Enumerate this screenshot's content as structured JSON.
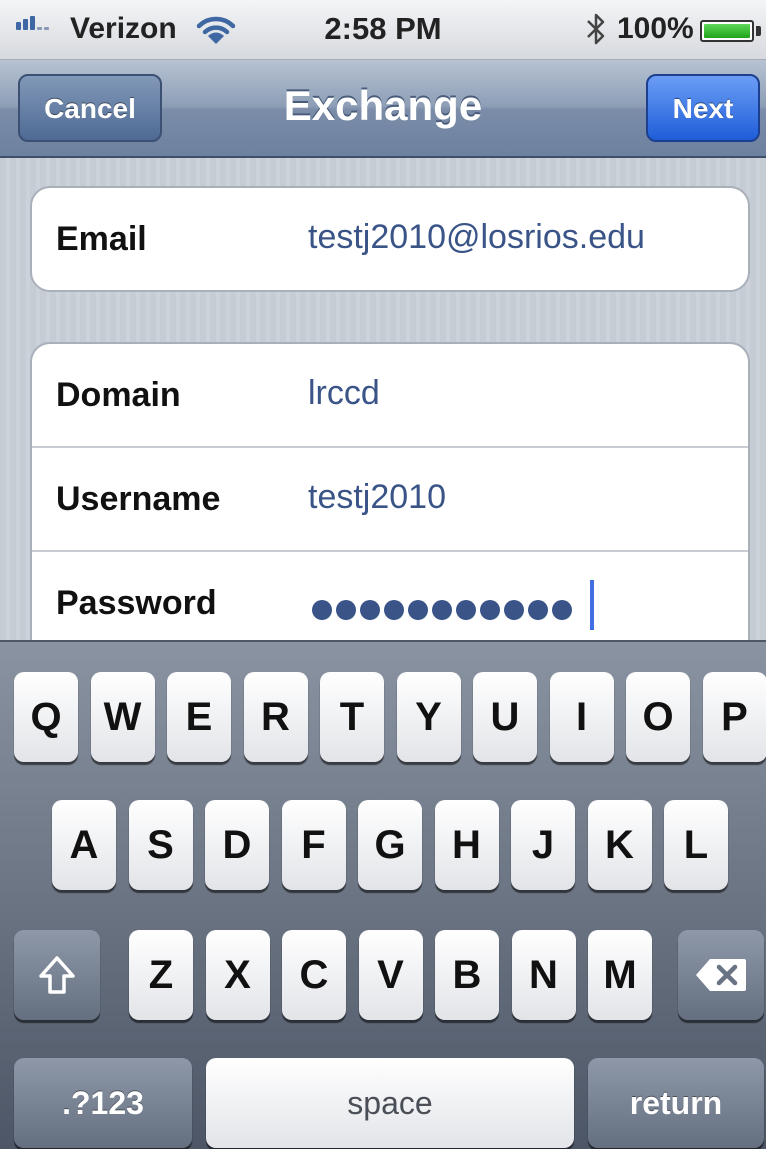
{
  "status_bar": {
    "carrier": "Verizon",
    "time": "2:58 PM",
    "battery_percent": "100%",
    "icons": [
      "signal-icon",
      "wifi-icon",
      "bluetooth-icon",
      "battery-icon"
    ]
  },
  "nav_bar": {
    "title": "Exchange",
    "cancel_label": "Cancel",
    "next_label": "Next"
  },
  "form": {
    "email": {
      "label": "Email",
      "value": "testj2010@losrios.edu"
    },
    "domain": {
      "label": "Domain",
      "value": "lrccd"
    },
    "username": {
      "label": "Username",
      "value": "testj2010"
    },
    "password": {
      "label": "Password",
      "masked_length": 11
    }
  },
  "keyboard": {
    "row1": [
      "Q",
      "W",
      "E",
      "R",
      "T",
      "Y",
      "U",
      "I",
      "O",
      "P"
    ],
    "row2": [
      "A",
      "S",
      "D",
      "F",
      "G",
      "H",
      "J",
      "K",
      "L"
    ],
    "row3": [
      "Z",
      "X",
      "C",
      "V",
      "B",
      "N",
      "M"
    ],
    "numbers_label": ".?123",
    "space_label": "space",
    "return_label": "return",
    "icons": [
      "shift-icon",
      "backspace-icon"
    ]
  },
  "colors": {
    "nav_accent": "#1f5ed9",
    "value_text": "#3a5487",
    "caret": "#3f6fe0"
  }
}
